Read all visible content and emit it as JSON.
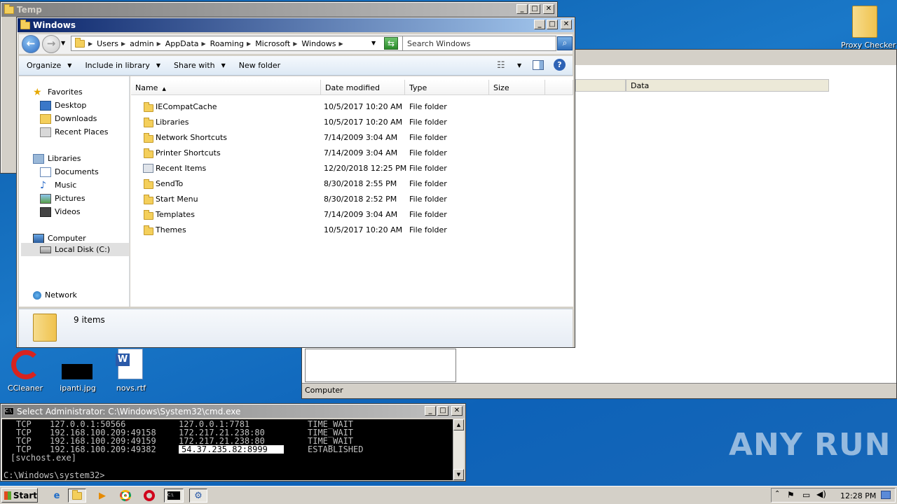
{
  "temp_window": {
    "title": "Temp",
    "right_panel_column": "Data",
    "status": "Computer"
  },
  "explorer": {
    "title": "Windows",
    "breadcrumb": [
      "Users",
      "admin",
      "AppData",
      "Roaming",
      "Microsoft",
      "Windows"
    ],
    "search_placeholder": "Search Windows",
    "toolbar": {
      "organize": "Organize",
      "include": "Include in library",
      "share": "Share with",
      "new_folder": "New folder"
    },
    "nav": {
      "favorites": "Favorites",
      "desktop": "Desktop",
      "downloads": "Downloads",
      "recent_places": "Recent Places",
      "libraries": "Libraries",
      "documents": "Documents",
      "music": "Music",
      "pictures": "Pictures",
      "videos": "Videos",
      "computer": "Computer",
      "local_disk": "Local Disk (C:)",
      "network": "Network"
    },
    "columns": {
      "name": "Name",
      "date": "Date modified",
      "type": "Type",
      "size": "Size"
    },
    "files": [
      {
        "name": "IECompatCache",
        "date": "10/5/2017 10:20 AM",
        "type": "File folder"
      },
      {
        "name": "Libraries",
        "date": "10/5/2017 10:20 AM",
        "type": "File folder"
      },
      {
        "name": "Network Shortcuts",
        "date": "7/14/2009 3:04 AM",
        "type": "File folder"
      },
      {
        "name": "Printer Shortcuts",
        "date": "7/14/2009 3:04 AM",
        "type": "File folder"
      },
      {
        "name": "Recent Items",
        "date": "12/20/2018 12:25 PM",
        "type": "File folder"
      },
      {
        "name": "SendTo",
        "date": "8/30/2018 2:55 PM",
        "type": "File folder"
      },
      {
        "name": "Start Menu",
        "date": "8/30/2018 2:52 PM",
        "type": "File folder"
      },
      {
        "name": "Templates",
        "date": "7/14/2009 3:04 AM",
        "type": "File folder"
      },
      {
        "name": "Themes",
        "date": "10/5/2017 10:20 AM",
        "type": "File folder"
      }
    ],
    "item_count": "9 items"
  },
  "cmd": {
    "title": "Select Administrator: C:\\Windows\\System32\\cmd.exe",
    "lines": [
      {
        "proto": "TCP",
        "local": "127.0.0.1:50566",
        "foreign": "127.0.0.1:7781",
        "state": "TIME_WAIT"
      },
      {
        "proto": "TCP",
        "local": "192.168.100.209:49158",
        "foreign": "172.217.21.238:80",
        "state": "TIME_WAIT"
      },
      {
        "proto": "TCP",
        "local": "192.168.100.209:49159",
        "foreign": "172.217.21.238:80",
        "state": "TIME_WAIT"
      },
      {
        "proto": "TCP",
        "local": "192.168.100.209:49382",
        "foreign": "54.37.235.82:8999",
        "state": "ESTABLISHED"
      }
    ],
    "process": "[svchost.exe]",
    "prompt": "C:\\Windows\\system32>"
  },
  "desktop_icons": {
    "proxy_checker": "Proxy Checker",
    "ccleaner": "CCleaner",
    "ipanti": "ipanti.jpg",
    "novs": "novs.rtf"
  },
  "taskbar": {
    "start": "Start",
    "clock": "12:28 PM"
  },
  "watermark": "ANY RUN"
}
